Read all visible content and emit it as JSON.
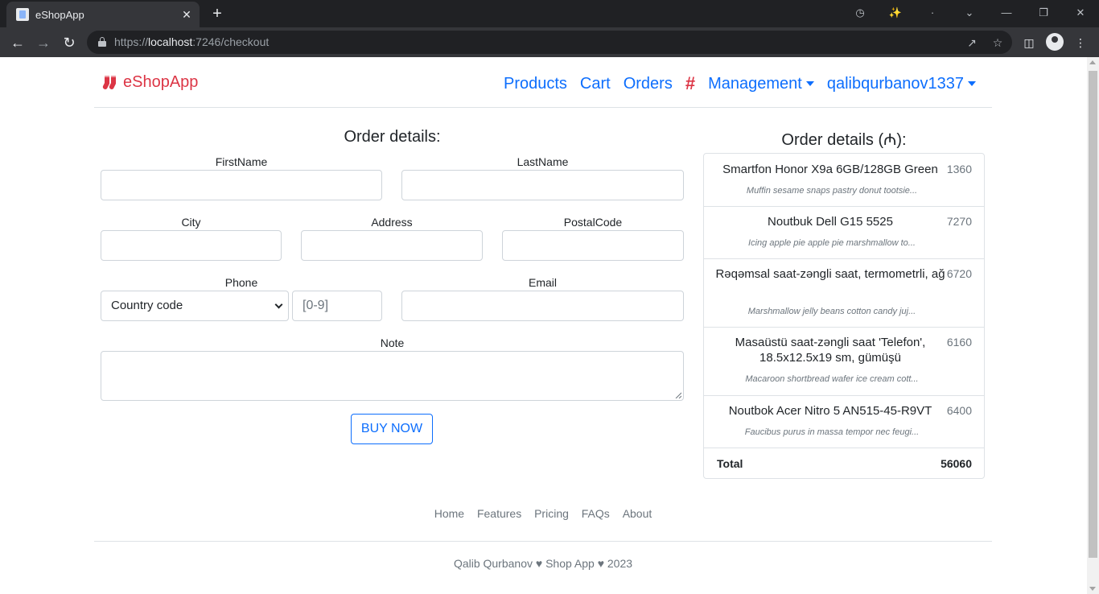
{
  "browser": {
    "tab_title": "eShopApp",
    "tab_close": "✕",
    "new_tab": "+",
    "url_scheme": "https://",
    "url_host": "localhost",
    "url_rest": ":7246/checkout"
  },
  "brand": {
    "name": "eShopApp",
    "color": "#dc3545"
  },
  "nav": {
    "products": "Products",
    "cart": "Cart",
    "orders": "Orders",
    "hash": "#",
    "management": "Management",
    "user": "qalibqurbanov1337"
  },
  "form": {
    "title": "Order details:",
    "firstname_label": "FirstName",
    "lastname_label": "LastName",
    "city_label": "City",
    "address_label": "Address",
    "postalcode_label": "PostalCode",
    "phone_label": "Phone",
    "country_code": "Country code",
    "phone_placeholder": "[0-9]",
    "email_label": "Email",
    "note_label": "Note",
    "buy_button": "BUY NOW"
  },
  "summary": {
    "title": "Order details (₼):",
    "items": [
      {
        "name": "Smartfon Honor X9a 6GB/128GB Green",
        "price": "1360",
        "desc": "Muffin sesame snaps pastry donut tootsie..."
      },
      {
        "name": "Noutbuk Dell G15 5525",
        "price": "7270",
        "desc": "Icing apple pie apple pie marshmallow to..."
      },
      {
        "name": "Rəqəmsal saat-zəngli saat, termometrli, ağ",
        "price": "6720",
        "desc": "Marshmallow jelly beans cotton candy juj..."
      },
      {
        "name": "Masaüstü saat-zəngli saat 'Telefon', 18.5x12.5x19 sm, gümüşü",
        "price": "6160",
        "desc": "Macaroon shortbread wafer ice cream cott..."
      },
      {
        "name": "Noutbok Acer Nitro 5 AN515-45-R9VT",
        "price": "6400",
        "desc": "Faucibus purus in massa tempor nec feugi..."
      }
    ],
    "total_label": "Total",
    "total_value": "56060"
  },
  "footer": {
    "links": [
      "Home",
      "Features",
      "Pricing",
      "FAQs",
      "About"
    ],
    "copyright": "Qalib Qurbanov ♥ Shop App ♥ 2023"
  }
}
